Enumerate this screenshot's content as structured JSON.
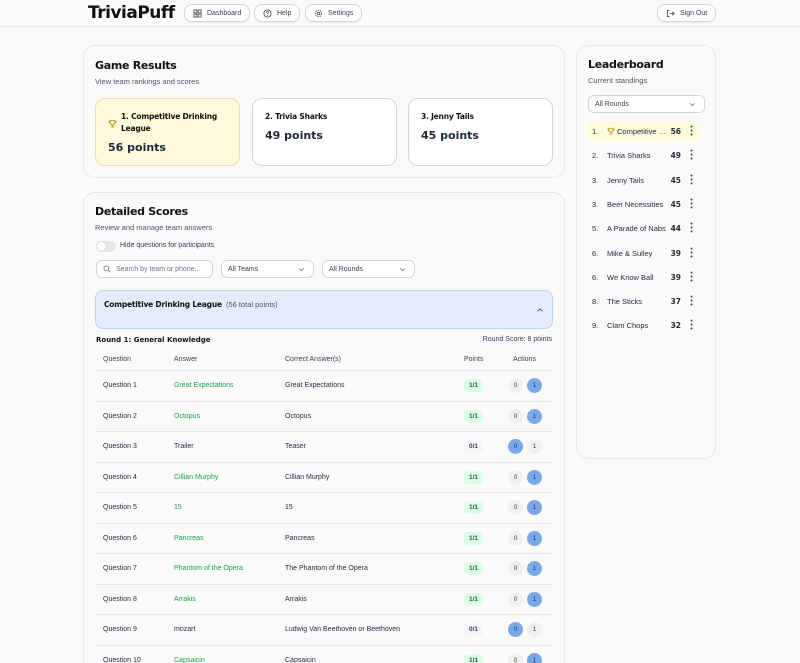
{
  "app": {
    "logo": "TriviaPuff"
  },
  "nav": {
    "dashboard": "Dashboard",
    "help": "Help",
    "settings": "Settings",
    "signout": "Sign Out"
  },
  "results": {
    "title": "Game Results",
    "subtitle": "View team rankings and scores",
    "top": [
      {
        "name": "1. Competitive Drinking League",
        "points": "56 points"
      },
      {
        "name": "2. Trivia Sharks",
        "points": "49 points"
      },
      {
        "name": "3. Jenny Tails",
        "points": "45 points"
      }
    ]
  },
  "detailed": {
    "title": "Detailed Scores",
    "subtitle": "Review and manage team answers",
    "toggle_label": "Hide questions for participants",
    "search_placeholder": "Search by team or phone...",
    "team_filter": "All Teams",
    "round_filter": "All Rounds",
    "team_name": "Competitive Drinking League",
    "team_total": "(56 total points)",
    "round_title": "Round 1: General Knowledge",
    "round_score": "Round Score: 8 points",
    "headers": {
      "question": "Question",
      "answer": "Answer",
      "correct": "Correct Answer(s)",
      "points": "Points",
      "actions": "Actions"
    },
    "rows": [
      {
        "q": "Question 1",
        "a": "Great Expectations",
        "c": "Great Expectations",
        "p": "1/1",
        "ok": true
      },
      {
        "q": "Question 2",
        "a": "Octopus",
        "c": "Octopus",
        "p": "1/1",
        "ok": true
      },
      {
        "q": "Question 3",
        "a": "Trailer",
        "c": "Teaser",
        "p": "0/1",
        "ok": false
      },
      {
        "q": "Question 4",
        "a": "Cillian Murphy",
        "c": "Cillian Murphy",
        "p": "1/1",
        "ok": true
      },
      {
        "q": "Question 5",
        "a": "15",
        "c": "15",
        "p": "1/1",
        "ok": true
      },
      {
        "q": "Question 6",
        "a": "Pancreas",
        "c": "Pancreas",
        "p": "1/1",
        "ok": true
      },
      {
        "q": "Question 7",
        "a": "Phantom of the Opera",
        "c": "The Phantom of the Opera",
        "p": "1/1",
        "ok": true
      },
      {
        "q": "Question 8",
        "a": "Arrakis",
        "c": "Arrakis",
        "p": "1/1",
        "ok": true
      },
      {
        "q": "Question 9",
        "a": "mozart",
        "c": "Ludwig Van Beethoven or Beethoven",
        "p": "0/1",
        "ok": false
      },
      {
        "q": "Question 10",
        "a": "Capsaicin",
        "c": "Capsaicin",
        "p": "1/1",
        "ok": true
      }
    ],
    "action_zero": "0",
    "action_one": "1"
  },
  "leaderboard": {
    "title": "Leaderboard",
    "subtitle": "Current standings",
    "filter": "All Rounds",
    "items": [
      {
        "rank": "1.",
        "name": "Competitive Drinking League",
        "score": "56"
      },
      {
        "rank": "2.",
        "name": "Trivia Sharks",
        "score": "49"
      },
      {
        "rank": "3.",
        "name": "Jenny Tails",
        "score": "45"
      },
      {
        "rank": "3.",
        "name": "Beer Necessities",
        "score": "45"
      },
      {
        "rank": "5.",
        "name": "A Parade of Nabs",
        "score": "44"
      },
      {
        "rank": "6.",
        "name": "Mike & Sulley",
        "score": "39"
      },
      {
        "rank": "6.",
        "name": "We Know Ball",
        "score": "39"
      },
      {
        "rank": "8.",
        "name": "The Sticks",
        "score": "37"
      },
      {
        "rank": "9.",
        "name": "Clam Chops",
        "score": "32"
      }
    ]
  },
  "colors": {
    "correct": "#16a34a",
    "accent_blue": "#7aa7e8",
    "gold": "#fdf9dd"
  }
}
